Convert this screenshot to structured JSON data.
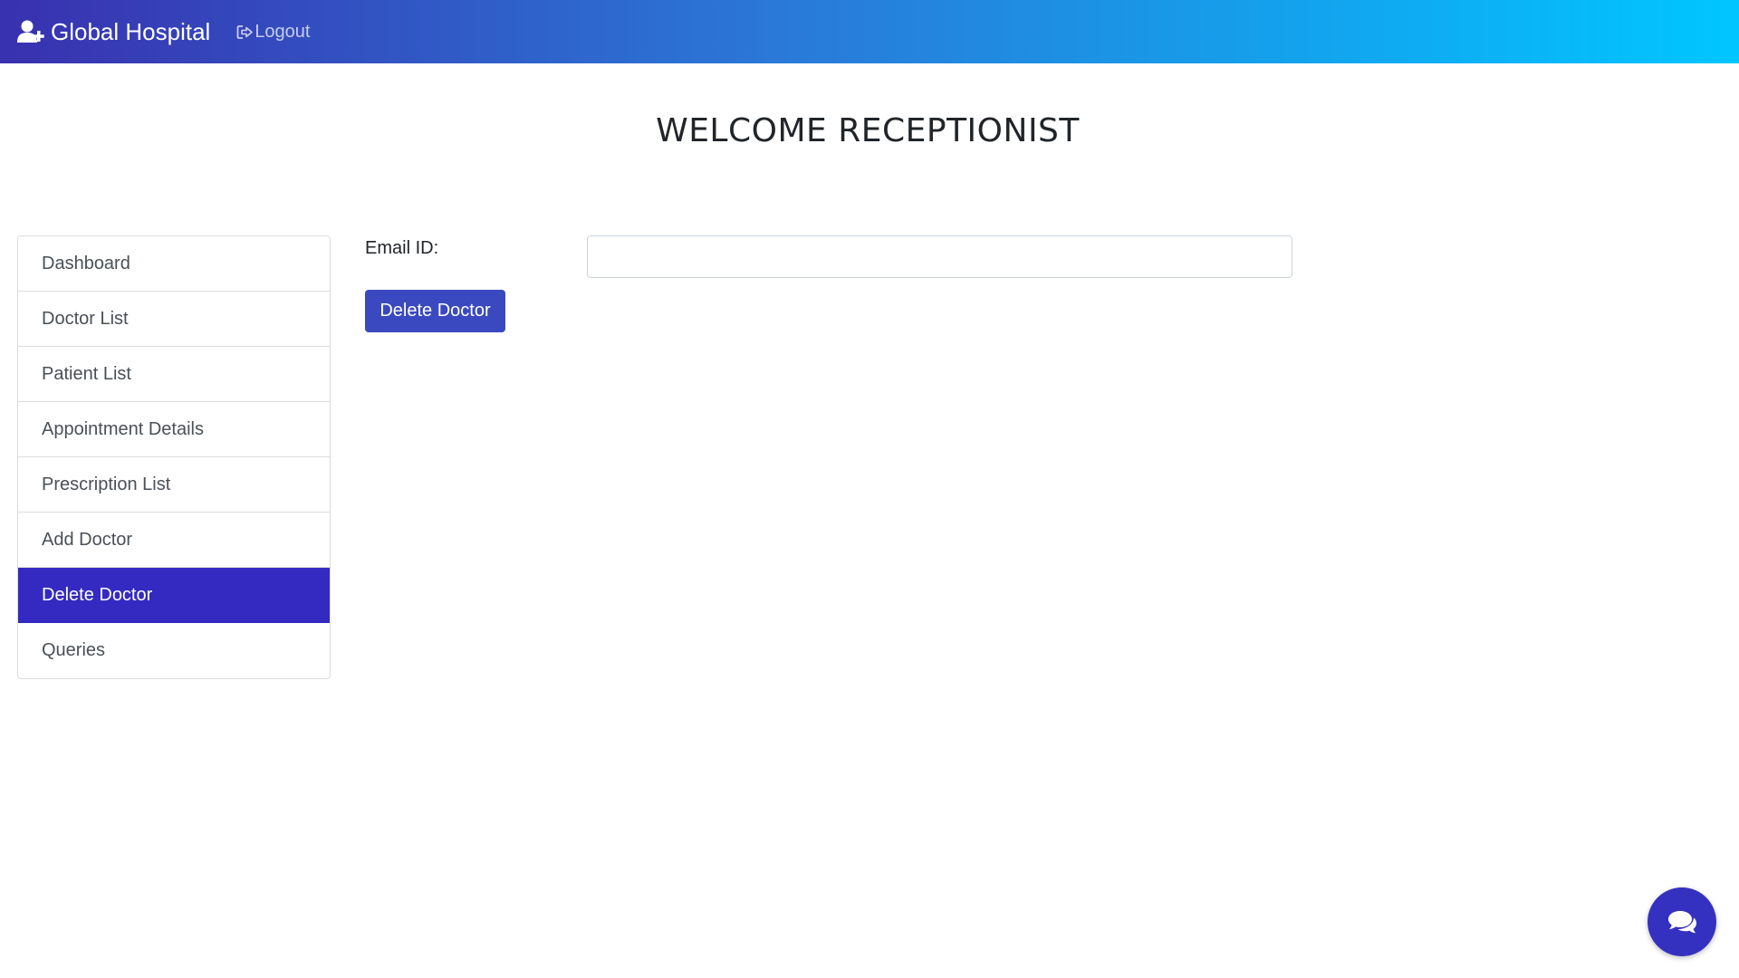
{
  "navbar": {
    "brand_icon": "user-plus-icon",
    "brand": "Global Hospital",
    "logout_icon": "sign-out-icon",
    "logout": "Logout",
    "gradient": [
      "#3931af",
      "#00c6ff"
    ]
  },
  "page": {
    "welcome": "WELCOME RECEPTIONIST"
  },
  "sidebar": {
    "items": [
      {
        "label": "Dashboard"
      },
      {
        "label": "Doctor List"
      },
      {
        "label": "Patient List"
      },
      {
        "label": "Appointment Details"
      },
      {
        "label": "Prescription List"
      },
      {
        "label": "Add Doctor"
      },
      {
        "label": "Delete Doctor",
        "active": true
      },
      {
        "label": "Queries"
      }
    ],
    "active_color": "#342ac1"
  },
  "form": {
    "email_label": "Email ID:",
    "email_value": "",
    "submit_label": "Delete Doctor",
    "button_color": "#3a49c0"
  },
  "chat": {
    "icon": "comments-icon",
    "color": "#3531c0"
  }
}
